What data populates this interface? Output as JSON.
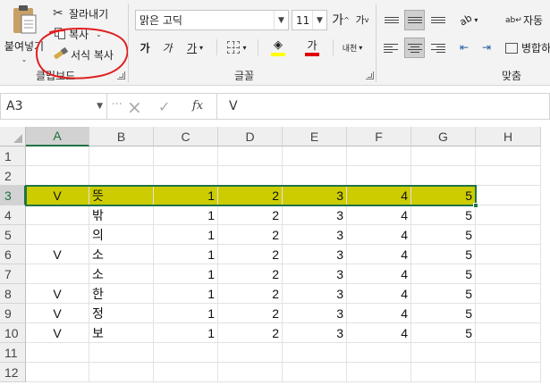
{
  "ribbon": {
    "clipboard": {
      "paste_label": "붙여넣기",
      "cut_label": "잘라내기",
      "copy_label": "복사",
      "format_painter_label": "서식 복사",
      "group_label": "클립보드"
    },
    "font": {
      "font_name": "맑은 고딕",
      "font_size": "11",
      "grow_label": "가",
      "shrink_label": "가",
      "bold_label": "가",
      "italic_label": "가",
      "underline_label": "가",
      "font_color_label": "가",
      "phonetic_label": "내천",
      "group_label": "글꼴",
      "font_color": "#e00000",
      "fill_color": "#ffff00"
    },
    "alignment": {
      "wrap_label": "자동",
      "merge_label": "병합하",
      "group_label": "맞춤"
    }
  },
  "formula_bar": {
    "name_box": "A3",
    "cancel_icon": "×",
    "enter_icon": "✓",
    "fx_label": "fx",
    "content": "V"
  },
  "sheet": {
    "columns": [
      "A",
      "B",
      "C",
      "D",
      "E",
      "F",
      "G",
      "H"
    ],
    "active_column": "A",
    "rows": [
      {
        "num": "1",
        "a": "",
        "b": "",
        "c": "",
        "d": "",
        "e": "",
        "f": "",
        "g": ""
      },
      {
        "num": "2",
        "a": "",
        "b": "",
        "c": "",
        "d": "",
        "e": "",
        "f": "",
        "g": ""
      },
      {
        "num": "3",
        "a": "V",
        "b": "뜻",
        "c": "1",
        "d": "2",
        "e": "3",
        "f": "4",
        "g": "5",
        "highlight": true
      },
      {
        "num": "4",
        "a": "",
        "b": "밖",
        "c": "1",
        "d": "2",
        "e": "3",
        "f": "4",
        "g": "5"
      },
      {
        "num": "5",
        "a": "",
        "b": "의",
        "c": "1",
        "d": "2",
        "e": "3",
        "f": "4",
        "g": "5"
      },
      {
        "num": "6",
        "a": "V",
        "b": "소",
        "c": "1",
        "d": "2",
        "e": "3",
        "f": "4",
        "g": "5"
      },
      {
        "num": "7",
        "a": "",
        "b": "소",
        "c": "1",
        "d": "2",
        "e": "3",
        "f": "4",
        "g": "5"
      },
      {
        "num": "8",
        "a": "V",
        "b": "한",
        "c": "1",
        "d": "2",
        "e": "3",
        "f": "4",
        "g": "5"
      },
      {
        "num": "9",
        "a": "V",
        "b": "정",
        "c": "1",
        "d": "2",
        "e": "3",
        "f": "4",
        "g": "5"
      },
      {
        "num": "10",
        "a": "V",
        "b": "보",
        "c": "1",
        "d": "2",
        "e": "3",
        "f": "4",
        "g": "5"
      },
      {
        "num": "11",
        "a": "",
        "b": "",
        "c": "",
        "d": "",
        "e": "",
        "f": "",
        "g": ""
      },
      {
        "num": "12",
        "a": "",
        "b": "",
        "c": "",
        "d": "",
        "e": "",
        "f": "",
        "g": ""
      }
    ],
    "highlight_color": "#cccc00",
    "selection_color": "#217346"
  },
  "annotation": {
    "shape": "red-hand-drawn-circle",
    "color": "#e02020"
  }
}
